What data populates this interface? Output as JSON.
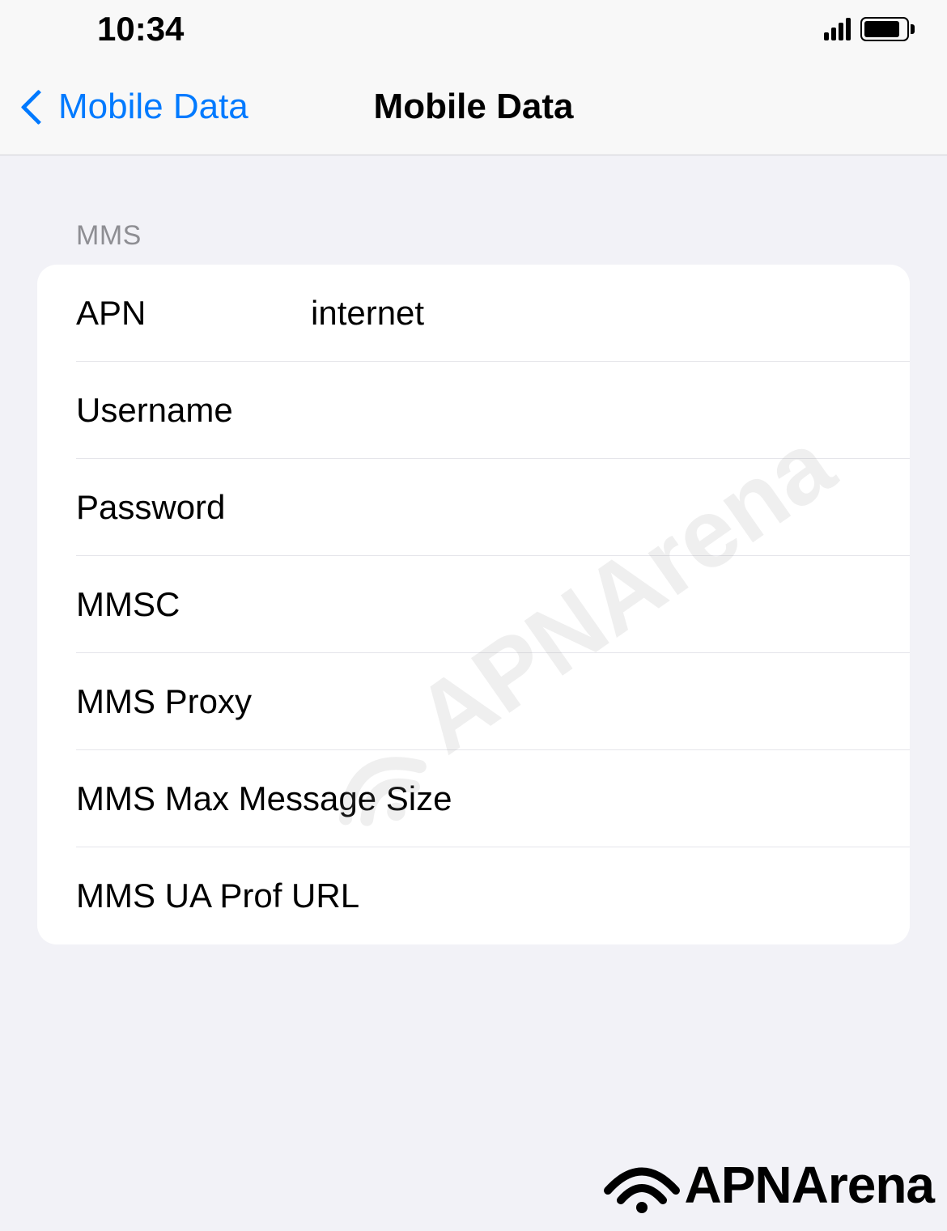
{
  "status_bar": {
    "time": "10:34"
  },
  "nav": {
    "back_label": "Mobile Data",
    "title": "Mobile Data"
  },
  "section": {
    "header": "MMS",
    "rows": [
      {
        "label": "APN",
        "value": "internet"
      },
      {
        "label": "Username",
        "value": ""
      },
      {
        "label": "Password",
        "value": ""
      },
      {
        "label": "MMSC",
        "value": ""
      },
      {
        "label": "MMS Proxy",
        "value": ""
      },
      {
        "label": "MMS Max Message Size",
        "value": ""
      },
      {
        "label": "MMS UA Prof URL",
        "value": ""
      }
    ]
  },
  "watermark": "APNArena",
  "footer_brand": "APNArena"
}
